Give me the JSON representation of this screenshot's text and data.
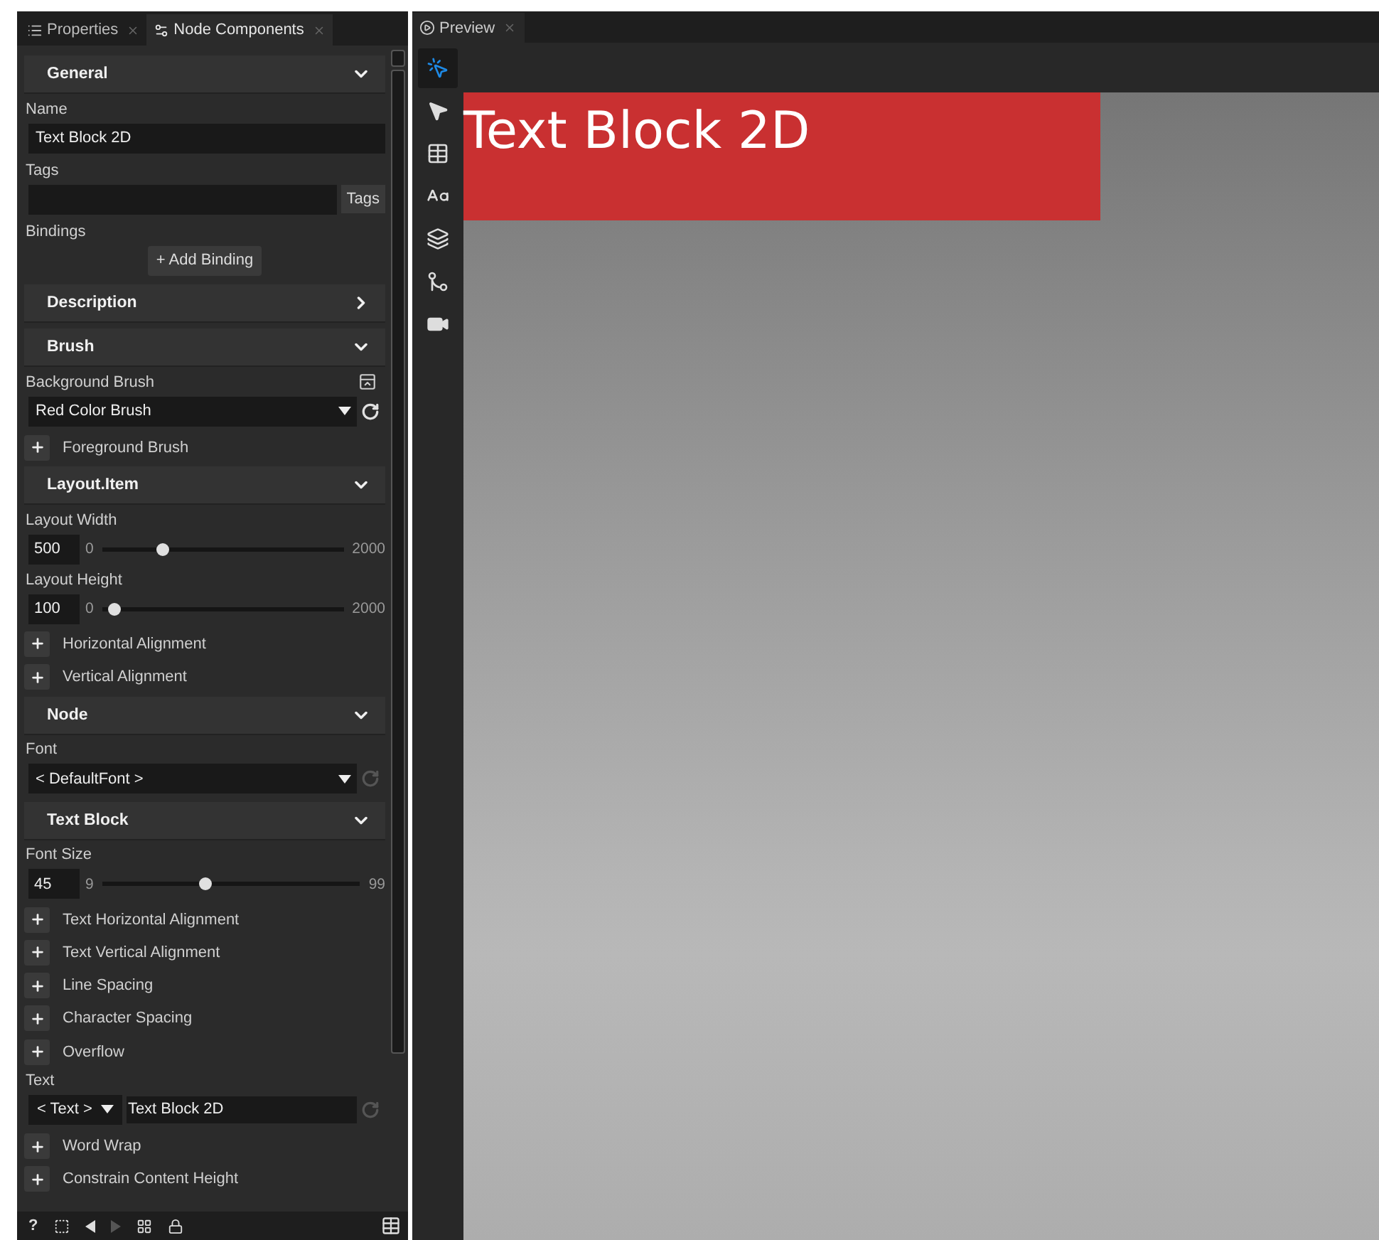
{
  "left_tabs": [
    {
      "label": "Properties",
      "selected": false
    },
    {
      "label": "Node Components",
      "selected": true
    }
  ],
  "properties": [
    {
      "kind": "header",
      "title": "General",
      "expanded": true
    },
    {
      "kind": "label",
      "text": "Name"
    },
    {
      "kind": "text-field",
      "value": "Text Block 2D"
    },
    {
      "kind": "label",
      "text": "Tags"
    },
    {
      "kind": "tags-field",
      "button": "Tags"
    },
    {
      "kind": "label",
      "text": "Bindings"
    },
    {
      "kind": "button",
      "text": "+ Add Binding"
    },
    {
      "kind": "header",
      "title": "Description",
      "expanded": false
    },
    {
      "kind": "header",
      "title": "Brush",
      "expanded": true
    },
    {
      "kind": "label-editor",
      "text": "Background Brush"
    },
    {
      "kind": "dropdown",
      "value": "Red Color Brush",
      "reset_enabled": true
    },
    {
      "kind": "expander",
      "text": "Foreground Brush"
    },
    {
      "kind": "header",
      "title": "Layout.Item",
      "expanded": true
    },
    {
      "kind": "label",
      "text": "Layout Width"
    },
    {
      "kind": "slider",
      "value": "500",
      "min": "0",
      "max": "2000",
      "level": 0.25
    },
    {
      "kind": "label",
      "text": "Layout Height"
    },
    {
      "kind": "slider",
      "value": "100",
      "min": "0",
      "max": "2000",
      "level": 0.05
    },
    {
      "kind": "expander",
      "text": "Horizontal Alignment"
    },
    {
      "kind": "expander",
      "text": "Vertical Alignment"
    },
    {
      "kind": "header",
      "title": "Node",
      "expanded": true
    },
    {
      "kind": "label",
      "text": "Font"
    },
    {
      "kind": "dropdown",
      "value": "< DefaultFont >",
      "reset_enabled": false
    },
    {
      "kind": "header",
      "title": "Text Block",
      "expanded": true
    },
    {
      "kind": "label",
      "text": "Font Size"
    },
    {
      "kind": "slider",
      "value": "45",
      "min": "9",
      "max": "99",
      "level": 0.4
    },
    {
      "kind": "expander",
      "text": "Text Horizontal Alignment"
    },
    {
      "kind": "expander",
      "text": "Text Vertical Alignment"
    },
    {
      "kind": "expander",
      "text": "Line Spacing"
    },
    {
      "kind": "expander",
      "text": "Character Spacing"
    },
    {
      "kind": "expander",
      "text": "Overflow"
    },
    {
      "kind": "label",
      "text": "Text"
    },
    {
      "kind": "binding-field",
      "type": "< Text >",
      "value": "Text Block 2D"
    },
    {
      "kind": "expander",
      "text": "Word Wrap"
    },
    {
      "kind": "expander",
      "text": "Constrain Content Height"
    }
  ],
  "bottom_bar": {
    "help": "?"
  },
  "preview_tab": {
    "label": "Preview"
  },
  "preview_tools": [
    {
      "selected": true
    },
    {
      "selected": false
    },
    {
      "selected": false
    },
    {
      "selected": false
    },
    {
      "selected": false
    },
    {
      "selected": false
    },
    {
      "selected": false
    }
  ],
  "text_block": {
    "text": "Text Block 2D"
  }
}
